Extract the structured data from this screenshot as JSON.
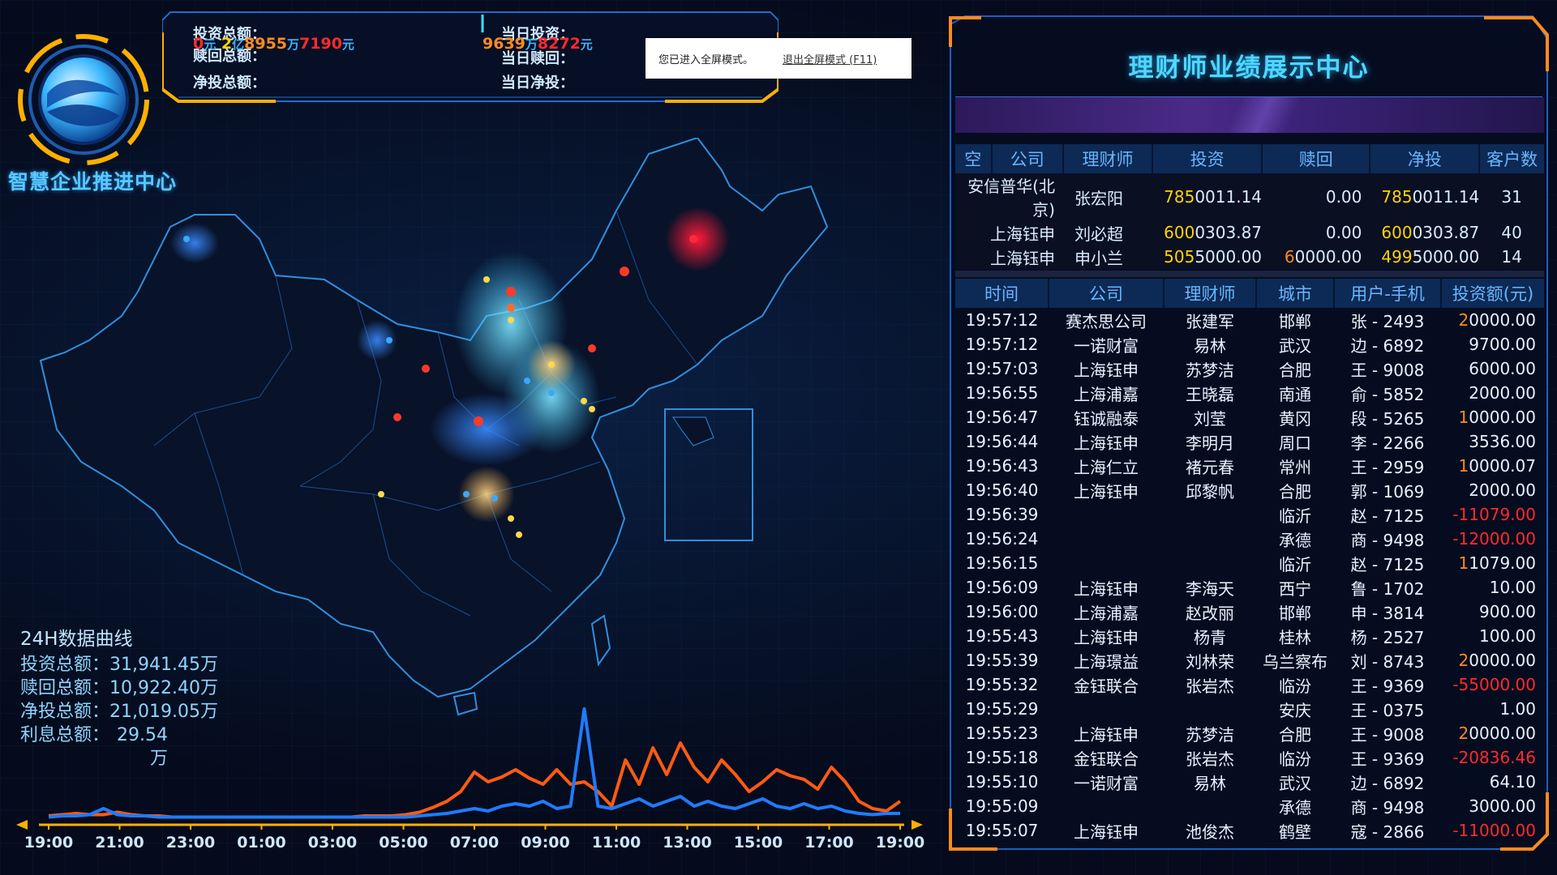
{
  "logo": {
    "text": "智慧企业推进中心"
  },
  "stats": {
    "invest_total_label": "投资总额：",
    "redeem_total_label": "赎回总额：",
    "net_total_label": "净投总额：",
    "today_invest_label": "当日投资：",
    "today_redeem_label": "当日赎回：",
    "today_net_label": "当日净投：",
    "invest_total_value": {
      "a": "0",
      "unit1": "元",
      "b": "2",
      "unit2": "亿",
      "c": "8955",
      "unit3": "万",
      "d": "7190",
      "unit4": "元"
    },
    "today_invest_value": {
      "a": "9639",
      "unit1": "万",
      "b": "8272",
      "unit2": "元"
    }
  },
  "toast": {
    "message": "您已进入全屏模式。",
    "exit_label": "退出全屏模式 (F11)"
  },
  "panel_24h": {
    "title": "24H数据曲线",
    "rows": [
      {
        "label": "投资总额：",
        "value": "31,941.45万"
      },
      {
        "label": "赎回总额：",
        "value": "10,922.40万"
      },
      {
        "label": "净投总额：",
        "value": "21,019.05万"
      },
      {
        "label": "利息总额：",
        "value": "29.54万"
      }
    ]
  },
  "chart_data": {
    "type": "line",
    "x_ticks": [
      "19:00",
      "21:00",
      "23:00",
      "01:00",
      "03:00",
      "05:00",
      "07:00",
      "09:00",
      "11:00",
      "13:00",
      "15:00",
      "17:00",
      "19:00"
    ],
    "series": [
      {
        "color": "#ff5a14",
        "values": [
          2,
          3,
          4,
          3,
          3,
          5,
          3,
          2,
          2,
          1,
          1,
          1,
          1,
          1,
          1,
          1,
          1,
          1,
          1,
          1,
          1,
          1,
          1,
          2,
          2,
          2,
          3,
          5,
          9,
          14,
          22,
          38,
          30,
          34,
          40,
          33,
          28,
          40,
          28,
          30,
          22,
          10,
          48,
          28,
          58,
          36,
          62,
          42,
          30,
          48,
          36,
          22,
          30,
          40,
          35,
          32,
          24,
          42,
          30,
          14,
          8,
          6,
          14
        ]
      },
      {
        "color": "#1f7bff",
        "values": [
          1,
          2,
          2,
          3,
          8,
          3,
          2,
          2,
          1,
          1,
          1,
          1,
          1,
          1,
          1,
          1,
          1,
          1,
          1,
          1,
          1,
          1,
          1,
          1,
          1,
          1,
          1,
          2,
          3,
          4,
          6,
          8,
          6,
          10,
          12,
          10,
          14,
          8,
          10,
          90,
          10,
          8,
          12,
          16,
          10,
          14,
          18,
          10,
          14,
          10,
          8,
          12,
          16,
          10,
          8,
          12,
          8,
          10,
          6,
          4,
          3,
          4,
          4
        ]
      }
    ],
    "ylim": [
      0,
      100
    ]
  },
  "right_panel": {
    "title": "理财师业绩展示中心",
    "top_table": {
      "headers": [
        "空",
        "公司",
        "理财师",
        "投资",
        "赎回",
        "净投",
        "客户数"
      ],
      "rows": [
        {
          "company": "安信普华(北京)",
          "advisor": "张宏阳",
          "invest_hi": "785",
          "invest_rest": "0011.14",
          "redeem_hi": "",
          "redeem_rest": "0.00",
          "net_hi": "785",
          "net_rest": "0011.14",
          "customers": "31"
        },
        {
          "company": "上海钰申",
          "advisor": "刘必超",
          "invest_hi": "600",
          "invest_rest": "0303.87",
          "redeem_hi": "",
          "redeem_rest": "0.00",
          "net_hi": "600",
          "net_rest": "0303.87",
          "customers": "40"
        },
        {
          "company": "上海钰申",
          "advisor": "申小兰",
          "invest_hi": "505",
          "invest_rest": "5000.00",
          "redeem_hi": "6",
          "redeem_rest": "0000.00",
          "net_hi": "499",
          "net_rest": "5000.00",
          "customers": "14"
        }
      ]
    },
    "live_table": {
      "headers": [
        "时间",
        "公司",
        "理财师",
        "城市",
        "用户-手机",
        "投资额(元)"
      ],
      "rows": [
        {
          "time": "19:57:12",
          "company": "赛杰思公司",
          "advisor": "张建军",
          "city": "邯郸",
          "user": "张 - 2493",
          "amount_hi": "2",
          "amount": "0000.00",
          "neg": false
        },
        {
          "time": "19:57:12",
          "company": "一诺财富",
          "advisor": "易林",
          "city": "武汉",
          "user": "边 - 6892",
          "amount_hi": "",
          "amount": "9700.00",
          "neg": false
        },
        {
          "time": "19:57:03",
          "company": "上海钰申",
          "advisor": "苏梦洁",
          "city": "合肥",
          "user": "王 - 9008",
          "amount_hi": "",
          "amount": "6000.00",
          "neg": false
        },
        {
          "time": "19:56:55",
          "company": "上海浦嘉",
          "advisor": "王晓磊",
          "city": "南通",
          "user": "俞 - 5852",
          "amount_hi": "",
          "amount": "2000.00",
          "neg": false
        },
        {
          "time": "19:56:47",
          "company": "钰诚融泰",
          "advisor": "刘莹",
          "city": "黄冈",
          "user": "段 - 5265",
          "amount_hi": "1",
          "amount": "0000.00",
          "neg": false
        },
        {
          "time": "19:56:44",
          "company": "上海钰申",
          "advisor": "李明月",
          "city": "周口",
          "user": "李 - 2266",
          "amount_hi": "",
          "amount": "3536.00",
          "neg": false
        },
        {
          "time": "19:56:43",
          "company": "上海仁立",
          "advisor": "褚元春",
          "city": "常州",
          "user": "王 - 2959",
          "amount_hi": "1",
          "amount": "0000.07",
          "neg": false
        },
        {
          "time": "19:56:40",
          "company": "上海钰申",
          "advisor": "邱黎帆",
          "city": "合肥",
          "user": "郭 - 1069",
          "amount_hi": "",
          "amount": "2000.00",
          "neg": false
        },
        {
          "time": "19:56:39",
          "company": "",
          "advisor": "",
          "city": "临沂",
          "user": "赵 - 7125",
          "amount_hi": "",
          "amount": "-11079.00",
          "neg": true
        },
        {
          "time": "19:56:24",
          "company": "",
          "advisor": "",
          "city": "承德",
          "user": "商 - 9498",
          "amount_hi": "",
          "amount": "-12000.00",
          "neg": true
        },
        {
          "time": "19:56:15",
          "company": "",
          "advisor": "",
          "city": "临沂",
          "user": "赵 - 7125",
          "amount_hi": "1",
          "amount": "1079.00",
          "neg": false
        },
        {
          "time": "19:56:09",
          "company": "上海钰申",
          "advisor": "李海天",
          "city": "西宁",
          "user": "鲁 - 1702",
          "amount_hi": "",
          "amount": "10.00",
          "neg": false
        },
        {
          "time": "19:56:00",
          "company": "上海浦嘉",
          "advisor": "赵改丽",
          "city": "邯郸",
          "user": "申 - 3814",
          "amount_hi": "",
          "amount": "900.00",
          "neg": false
        },
        {
          "time": "19:55:43",
          "company": "上海钰申",
          "advisor": "杨青",
          "city": "桂林",
          "user": "杨 - 2527",
          "amount_hi": "",
          "amount": "100.00",
          "neg": false
        },
        {
          "time": "19:55:39",
          "company": "上海璟益",
          "advisor": "刘林荣",
          "city": "乌兰察布",
          "user": "刘 - 8743",
          "amount_hi": "2",
          "amount": "0000.00",
          "neg": false
        },
        {
          "time": "19:55:32",
          "company": "金钰联合",
          "advisor": "张岩杰",
          "city": "临汾",
          "user": "王 - 9369",
          "amount_hi": "",
          "amount": "-55000.00",
          "neg": true
        },
        {
          "time": "19:55:29",
          "company": "",
          "advisor": "",
          "city": "安庆",
          "user": "王 - 0375",
          "amount_hi": "",
          "amount": "1.00",
          "neg": false
        },
        {
          "time": "19:55:23",
          "company": "上海钰申",
          "advisor": "苏梦洁",
          "city": "合肥",
          "user": "王 - 9008",
          "amount_hi": "2",
          "amount": "0000.00",
          "neg": false
        },
        {
          "time": "19:55:18",
          "company": "金钰联合",
          "advisor": "张岩杰",
          "city": "临汾",
          "user": "王 - 9369",
          "amount_hi": "",
          "amount": "-20836.46",
          "neg": true
        },
        {
          "time": "19:55:10",
          "company": "一诺财富",
          "advisor": "易林",
          "city": "武汉",
          "user": "边 - 6892",
          "amount_hi": "",
          "amount": "64.10",
          "neg": false
        },
        {
          "time": "19:55:09",
          "company": "",
          "advisor": "",
          "city": "承德",
          "user": "商 - 9498",
          "amount_hi": "",
          "amount": "3000.00",
          "neg": false
        },
        {
          "time": "19:55:07",
          "company": "上海钰申",
          "advisor": "池俊杰",
          "city": "鹤壁",
          "user": "寇 - 2866",
          "amount_hi": "",
          "amount": "-11000.00",
          "neg": true
        }
      ]
    }
  }
}
